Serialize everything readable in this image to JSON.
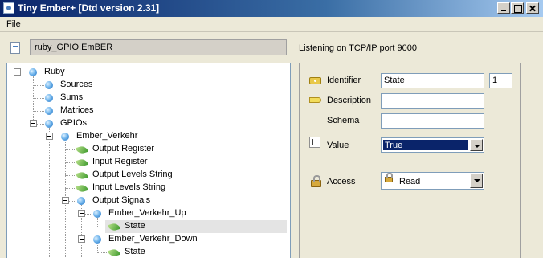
{
  "window": {
    "title": "Tiny Ember+ [Dtd version 2.31]",
    "app_icon": "app-icon",
    "controls": [
      "minimize",
      "maximize",
      "close"
    ]
  },
  "menu": {
    "items": [
      {
        "label": "File"
      }
    ]
  },
  "toolbar": {
    "path_value": "ruby_GPIO.EmBER",
    "path_icon": "document-icon",
    "status": "Listening on TCP/IP port 9000"
  },
  "tree": {
    "items": [
      {
        "label": "Ruby",
        "icon": "node-dot-icon",
        "expanded": true
      },
      {
        "label": "Sources",
        "icon": "node-dot-icon"
      },
      {
        "label": "Sums",
        "icon": "node-dot-icon"
      },
      {
        "label": "Matrices",
        "icon": "node-dot-icon"
      },
      {
        "label": "GPIOs",
        "icon": "node-dot-icon",
        "expanded": true
      },
      {
        "label": "Ember_Verkehr",
        "icon": "node-dot-icon",
        "expanded": true
      },
      {
        "label": "Output Register",
        "icon": "parameter-leaf-icon"
      },
      {
        "label": "Input Register",
        "icon": "parameter-leaf-icon"
      },
      {
        "label": "Output Levels String",
        "icon": "parameter-leaf-icon"
      },
      {
        "label": "Input Levels String",
        "icon": "parameter-leaf-icon"
      },
      {
        "label": "Output Signals",
        "icon": "node-dot-icon",
        "expanded": true
      },
      {
        "label": "Ember_Verkehr_Up",
        "icon": "node-dot-icon",
        "expanded": true
      },
      {
        "label": "State",
        "icon": "parameter-leaf-icon",
        "selected": true
      },
      {
        "label": "Ember_Verkehr_Down",
        "icon": "node-dot-icon",
        "expanded": true
      },
      {
        "label": "State",
        "icon": "parameter-leaf-icon"
      }
    ]
  },
  "properties": {
    "identifier": {
      "label": "Identifier",
      "value": "State",
      "number": "1",
      "icon": "identifier-key-icon"
    },
    "description": {
      "label": "Description",
      "value": "",
      "icon": "description-tag-icon"
    },
    "schema": {
      "label": "Schema",
      "value": ""
    },
    "value": {
      "label": "Value",
      "selected": "True",
      "icon": "value-cursor-icon"
    },
    "access": {
      "label": "Access",
      "selected": "Read",
      "icon": "access-lock-icon"
    }
  },
  "colors": {
    "title_bar": "#0a246a",
    "tree_selection": "#e4e4e4",
    "combo_highlight": "#0a246a"
  }
}
